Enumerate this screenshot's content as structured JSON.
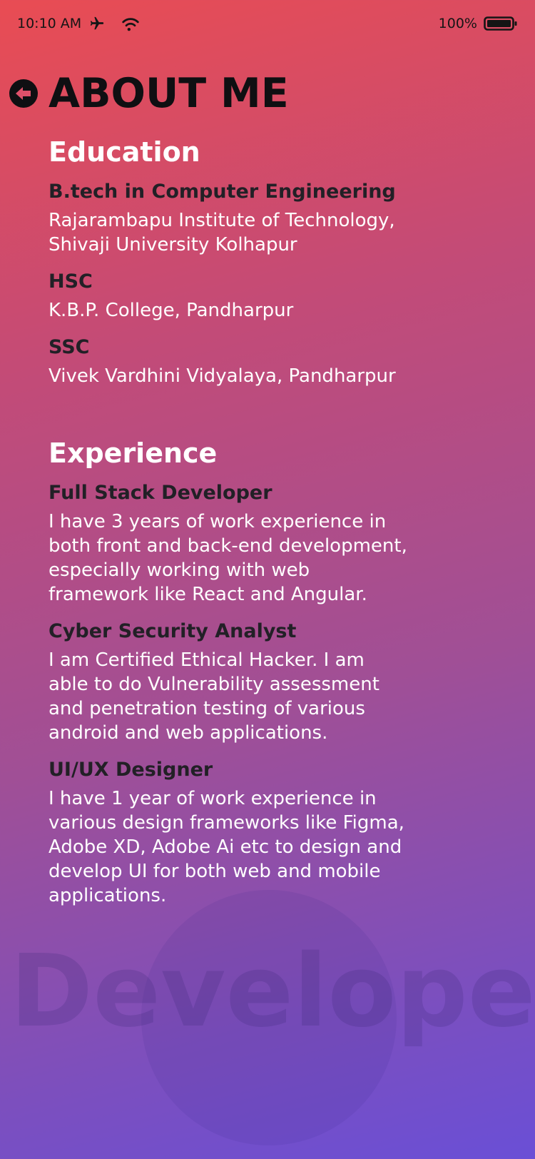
{
  "status_bar": {
    "time": "10:10 AM",
    "battery_pct": "100%",
    "icons": [
      "airplane-icon",
      "wifi-icon",
      "battery-icon"
    ]
  },
  "header": {
    "back_icon": "back-arrow-icon",
    "title": "ABOUT ME"
  },
  "education": {
    "heading": "Education",
    "items": [
      {
        "title": "B.tech in Computer Engineering",
        "desc": "Rajarambapu Institute of Technology,\nShivaji University Kolhapur"
      },
      {
        "title": "HSC",
        "desc": "K.B.P. College, Pandharpur"
      },
      {
        "title": "SSC",
        "desc": "Vivek Vardhini Vidyalaya, Pandharpur"
      }
    ]
  },
  "experience": {
    "heading": "Experience",
    "items": [
      {
        "title": "Full Stack Developer",
        "desc": "I have 3 years of work experience in\nboth front and back-end development,\nespecially working with web\nframework like React and Angular."
      },
      {
        "title": "Cyber Security Analyst",
        "desc": "I am Certified Ethical Hacker. I am\nable to do Vulnerability assessment\nand penetration testing of various\nandroid and web applications."
      },
      {
        "title": "UI/UX Designer",
        "desc": "I have 1 year of work experience in\nvarious design frameworks like Figma,\nAdobe XD, Adobe Ai etc to design and\ndevelop UI for both web and mobile\napplications."
      }
    ]
  },
  "watermark": "Developer",
  "colors": {
    "gradient_top": "#e94c53",
    "gradient_bottom": "#6a4fd6",
    "title_dark": "#0f0f12",
    "item_title": "#222026",
    "body_text": "#ffffff"
  }
}
